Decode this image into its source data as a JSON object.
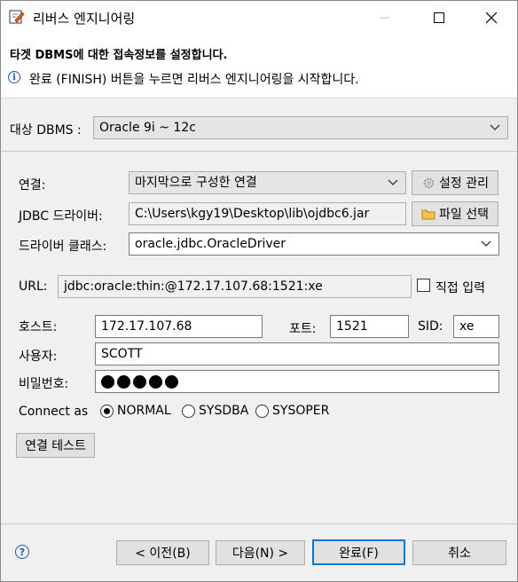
{
  "window": {
    "title": "리버스 엔지니어링",
    "minimize_icon": "minimize-icon",
    "maximize_icon": "maximize-icon",
    "close_icon": "close-icon"
  },
  "header": {
    "title": "타겟 DBMS에 대한 접속정보를 설정합니다.",
    "message": "완료 (FINISH) 버튼을 누르면 리버스 엔지니어링을 시작합니다."
  },
  "target": {
    "label": "대상 DBMS :",
    "value": "Oracle 9i ~ 12c"
  },
  "connection": {
    "label": "연결:",
    "value": "마지막으로 구성한 연결",
    "manage_button": "설정 관리"
  },
  "jdbc": {
    "label": "JDBC 드라이버:",
    "value": "C:\\Users\\kgy19\\Desktop\\lib\\ojdbc6.jar",
    "select_button": "파일 선택"
  },
  "driver_class": {
    "label": "드라이버 클래스:",
    "value": "oracle.jdbc.OracleDriver"
  },
  "url": {
    "label": "URL:",
    "value": "jdbc:oracle:thin:@172.17.107.68:1521:xe",
    "direct_input_label": "직접 입력"
  },
  "host": {
    "label": "호스트:",
    "value": "172.17.107.68"
  },
  "port": {
    "label": "포트:",
    "value": "1521"
  },
  "sid": {
    "label": "SID:",
    "value": "xe"
  },
  "user": {
    "label": "사용자:",
    "value": "SCOTT"
  },
  "password": {
    "label": "비밀번호:",
    "masked_length": 5
  },
  "connect_as": {
    "label": "Connect as",
    "options": [
      "NORMAL",
      "SYSDBA",
      "SYSOPER"
    ],
    "selected": "NORMAL"
  },
  "test_button": "연결 테스트",
  "footer": {
    "back": "< 이전(B)",
    "next": "다음(N) >",
    "finish": "완료(F)",
    "cancel": "취소"
  },
  "colors": {
    "accent": "#0078d7",
    "info": "#1a5fb4"
  }
}
